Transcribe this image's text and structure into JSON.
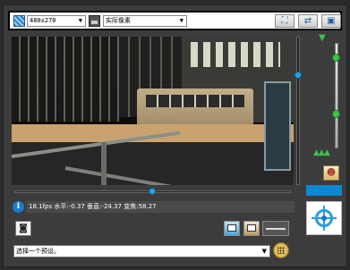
{
  "toolbar": {
    "resolution_value": "480x270",
    "image_mode_value": "实际像素",
    "fit_icon": "fit-screen-icon",
    "refresh_icon": "refresh-icon",
    "fullscreen_icon": "fullscreen-icon"
  },
  "video": {
    "status_text": "18.1fps 水平:-0.37 垂直:-24.37 变焦:58.27"
  },
  "preset": {
    "placeholder_value": "选择一个预设。"
  },
  "colors": {
    "accent": "#0c87d1",
    "zoom_green": "#3bc44a",
    "slider_blue": "#2aa4e0"
  }
}
